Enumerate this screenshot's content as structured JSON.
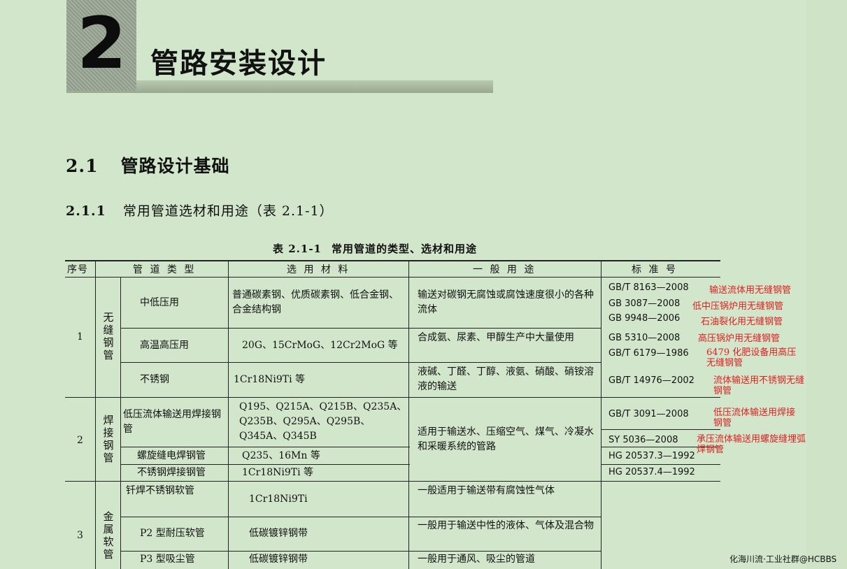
{
  "chapter": {
    "number": "2",
    "title": "管路安装设计"
  },
  "section": {
    "number": "2.1",
    "title": "管路设计基础"
  },
  "subsection": {
    "number": "2.1.1",
    "title": "常用管道选材和用途（表 2.1-1）"
  },
  "table": {
    "number": "表 2.1-1",
    "title": "常用管道的类型、选材和用途",
    "headers": {
      "no": "序号",
      "type": "管 道 类 型",
      "material": "选 用 材 料",
      "usage": "一 般 用 途",
      "standard": "标  准  号"
    },
    "groups": [
      {
        "no": "1",
        "name": "无缝钢管"
      },
      {
        "no": "2",
        "name": "焊接钢管"
      },
      {
        "no": "3",
        "name": "金属软管"
      }
    ],
    "rows": [
      {
        "type": "中低压用",
        "material": "普通碳素钢、优质碳素钢、低合金钢、合金结构钢",
        "usage": "输送对碳钢无腐蚀或腐蚀速度很小的各种流体"
      },
      {
        "type": "高温高压用",
        "material": "20G、15CrMoG、12Cr2MoG 等",
        "usage": "合成氨、尿素、甲醇生产中大量使用"
      },
      {
        "type": "不锈钢",
        "material": "1Cr18Ni9Ti 等",
        "usage": "液碱、丁醛、丁醇、液氨、硝酸、硝铵溶液的输送"
      },
      {
        "type": "低压流体输送用焊接钢管",
        "material": "Q195、Q215A、Q215B、Q235A、Q235B、Q295A、Q295B、Q345A、Q345B",
        "usage": "适用于输送水、压缩空气、煤气、冷凝水和采暖系统的管路"
      },
      {
        "type": "螺旋缝电焊钢管",
        "material": "Q235、16Mn 等",
        "usage": ""
      },
      {
        "type": "不锈钢焊接钢管",
        "material": "1Cr18Ni9Ti 等",
        "usage": ""
      },
      {
        "type": "钎焊不锈钢软管",
        "material": "1Cr18Ni9Ti",
        "usage": "一般适用于输送带有腐蚀性气体"
      },
      {
        "type": "P2 型耐压软管",
        "material": "低碳镀锌钢带",
        "usage": "一般用于输送中性的液体、气体及混合物"
      },
      {
        "type": "P3 型吸尘管",
        "material": "低碳镀锌钢带",
        "usage": "一般用于通风、吸尘的管道"
      }
    ],
    "standards": [
      {
        "code": "GB/T 8163—2008",
        "note": "输送流体用无缝钢管"
      },
      {
        "code": "GB 3087—2008",
        "note": "低中压锅炉用无缝钢管"
      },
      {
        "code": "GB 9948—2006",
        "note": "石油裂化用无缝钢管"
      },
      {
        "code": "GB 5310—2008",
        "note": "高压锅炉用无缝钢管"
      },
      {
        "code": "GB/T 6179—1986",
        "note": "6479  化肥设备用高压无缝钢管"
      },
      {
        "code": "GB/T 14976—2002",
        "note": "流体输送用不锈钢无缝钢管"
      },
      {
        "code": "GB/T 3091—2008",
        "note": "低压流体输送用焊接钢管"
      },
      {
        "code": "SY 5036—2008",
        "note": "承压流体输送用螺旋缝埋弧焊钢管"
      },
      {
        "code": "HG 20537.3—1992",
        "note": ""
      },
      {
        "code": "HG 20537.4—1992",
        "note": ""
      }
    ]
  },
  "watermark": "化海川流·工业社群@HCBBS",
  "colors": {
    "background": "#d2e6cb",
    "annotation": "#e02020"
  }
}
